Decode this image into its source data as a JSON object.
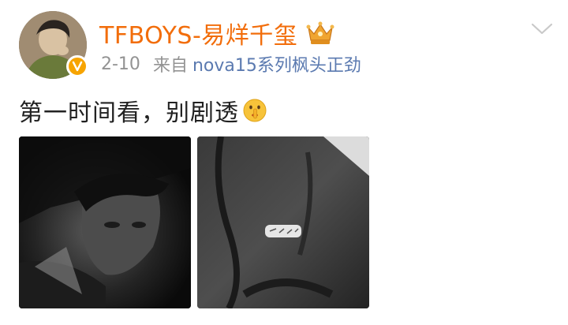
{
  "post": {
    "username": "TFBOYS-易烊千玺",
    "date": "2-10",
    "from_label": "来自",
    "device": "nova15系列枫头正劲",
    "text": "第一时间看，别剧透",
    "shush_icon": "shushing-face-emoji",
    "crown_icon": "crown-icon",
    "verified_icon": "verified-badge-icon",
    "menu_icon": "chevron-down-icon",
    "photos": [
      {
        "alt": "dark portrait photo"
      },
      {
        "alt": "dark jacket with badge photo"
      }
    ]
  },
  "colors": {
    "username": "#f26d0b",
    "meta": "#939393",
    "device": "#5b7ab0",
    "text": "#222222",
    "verified": "#f7a400"
  }
}
